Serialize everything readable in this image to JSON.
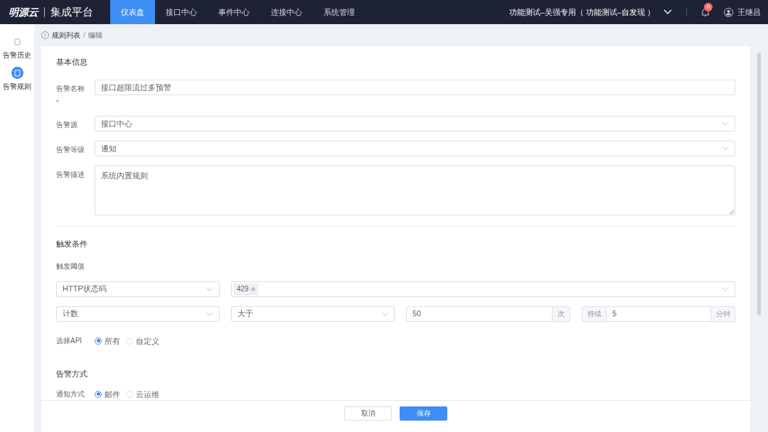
{
  "brand": {
    "logo": "明源云",
    "product": "集成平台"
  },
  "nav": [
    {
      "label": "仪表盘",
      "selected": true
    },
    {
      "label": "接口中心",
      "selected": false
    },
    {
      "label": "事件中心",
      "selected": false
    },
    {
      "label": "连接中心",
      "selected": false
    },
    {
      "label": "系统管理",
      "selected": false
    }
  ],
  "tenant": "功能测试–吴强专用（ 功能测试–自发现 ）",
  "notifications": "0",
  "user": "王继昌",
  "sidebar": [
    {
      "label": "告警历史",
      "selected": false
    },
    {
      "label": "告警规则",
      "selected": true
    }
  ],
  "breadcrumb": {
    "items": [
      "规则列表",
      "编辑"
    ],
    "separator": "/"
  },
  "basic": {
    "title": "基本信息",
    "fields": [
      {
        "kind": "input",
        "label": "告警名称",
        "value": "接口超限流过多预警",
        "required_mark": "*"
      },
      {
        "kind": "select",
        "label": "告警源",
        "value": "接口中心"
      },
      {
        "kind": "select",
        "label": "告警等级",
        "value": "通知"
      },
      {
        "kind": "textarea",
        "label": "告警描述",
        "value": "系统内置规则"
      }
    ]
  },
  "trigger": {
    "title": "触发条件",
    "threshold_label": "触发阈值",
    "metric": "HTTP状态码",
    "tags": [
      "429"
    ],
    "aggregate": "计数",
    "operator": "大于",
    "count": "50",
    "count_unit": "次",
    "duration_prefix": "持续",
    "duration": "5",
    "duration_unit": "分钟",
    "api": {
      "label": "选择API",
      "options": [
        {
          "label": "所有",
          "selected": true
        },
        {
          "label": "自定义",
          "selected": false
        }
      ]
    }
  },
  "alert": {
    "title": "告警方式",
    "label": "通知方式",
    "options": [
      {
        "label": "邮件",
        "selected": true
      },
      {
        "label": "云运维",
        "selected": false
      }
    ]
  },
  "buttons": [
    {
      "kind": "default",
      "label": "取消"
    },
    {
      "kind": "primary",
      "label": "保存"
    }
  ]
}
